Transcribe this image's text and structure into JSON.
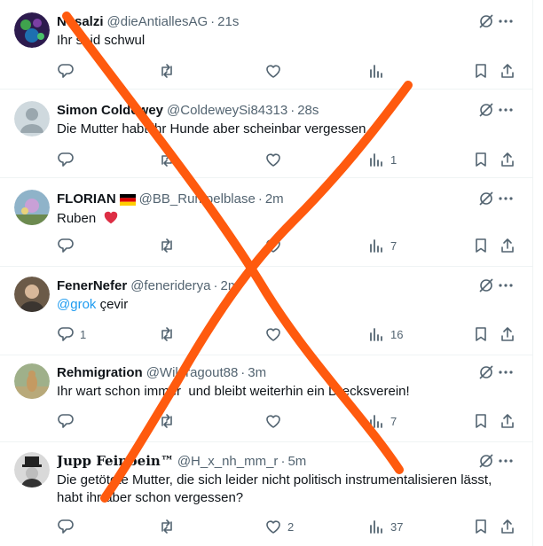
{
  "tweets": [
    {
      "name": "Nosalzi",
      "handle": "@dieAntiallesAG",
      "time": "21s",
      "text": "Ihr seid schwul",
      "counts": {
        "replies": "",
        "reposts": "",
        "likes": "",
        "views": ""
      },
      "avatar_color": "#2d1b4e"
    },
    {
      "name": "Simon Coldewey",
      "handle": "@ColdeweySi84313",
      "time": "28s",
      "text": "Die Mutter habt ihr Hunde aber scheinbar vergessen",
      "counts": {
        "replies": "",
        "reposts": "",
        "likes": "",
        "views": "1"
      },
      "avatar_color": "#cfd9de"
    },
    {
      "name": "FLORIAN",
      "flag": "germany-flag",
      "handle": "@BB_Rumpelblase",
      "time": "2m",
      "text": "Ruben",
      "emoji": "red-heart",
      "counts": {
        "replies": "",
        "reposts": "",
        "likes": "",
        "views": "7"
      },
      "avatar_color": "#8fb3c9"
    },
    {
      "name": "FenerNefer",
      "handle": "@fenerideryа",
      "time": "2m",
      "mention": "@grok",
      "text": "çevir",
      "counts": {
        "replies": "1",
        "reposts": "",
        "likes": "",
        "views": "16"
      },
      "avatar_color": "#6b5a48"
    },
    {
      "name": "Rehmigration",
      "handle": "@Wildragout88",
      "time": "3m",
      "text": "Ihr wart schon immer  und bleibt weiterhin ein Drecksverein!",
      "counts": {
        "replies": "",
        "reposts": "",
        "likes": "",
        "views": "7"
      },
      "avatar_color": "#9fb08a"
    },
    {
      "name": "Jupp Feinbein™",
      "handle": "@H_x_nh_mm_r",
      "time": "5m",
      "text": "Die getötete Mutter, die sich leider nicht politisch instrumentalisieren lässt, habt ihr aber schon vergessen?",
      "counts": {
        "replies": "",
        "reposts": "",
        "likes": "2",
        "views": "37"
      },
      "avatar_color": "#d9d9d9"
    }
  ],
  "colors": {
    "text": "#0f1419",
    "secondary": "#536471",
    "link": "#1d9bf0",
    "divider": "#eff3f4",
    "overlay_x": "#ff5a0e"
  }
}
